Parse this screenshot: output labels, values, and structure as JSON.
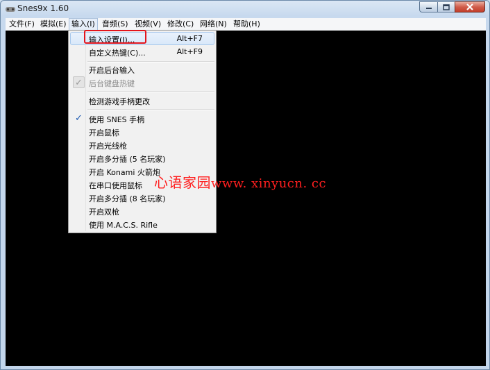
{
  "window": {
    "title": "Snes9x 1.60"
  },
  "menubar": [
    {
      "label": "文件(F)"
    },
    {
      "label": "模拟(E)"
    },
    {
      "label": "输入(I)",
      "active": true
    },
    {
      "label": "音频(S)"
    },
    {
      "label": "视频(V)"
    },
    {
      "label": "修改(C)"
    },
    {
      "label": "网络(N)"
    },
    {
      "label": "帮助(H)"
    }
  ],
  "input_menu": {
    "items": [
      {
        "label": "输入设置(I)...",
        "shortcut": "Alt+F7",
        "highlighted": true
      },
      {
        "label": "自定义热键(C)...",
        "shortcut": "Alt+F9"
      },
      {
        "label": "开启后台输入"
      },
      {
        "label": "后台键盘热键",
        "checked": true,
        "disabled": true
      },
      {
        "label": "检测游戏手柄更改"
      },
      {
        "label": "使用 SNES 手柄",
        "checked": true
      },
      {
        "label": "开启鼠标"
      },
      {
        "label": "开启光线枪"
      },
      {
        "label": "开启多分插 (5 名玩家)"
      },
      {
        "label": "开启 Konami 火箭炮"
      },
      {
        "label": "在串口使用鼠标"
      },
      {
        "label": "开启多分插 (8 名玩家)"
      },
      {
        "label": "开启双枪"
      },
      {
        "label": "使用 M.A.C.S. Rifle"
      }
    ],
    "check_glyph": "✓"
  },
  "watermark": {
    "cn": "心语家园",
    "url": "www. xinyucn. cc",
    "color": "#ff1f1f"
  },
  "colors": {
    "highlight_box": "#e3141c",
    "check": "#1856b0",
    "screen": "#000000"
  }
}
